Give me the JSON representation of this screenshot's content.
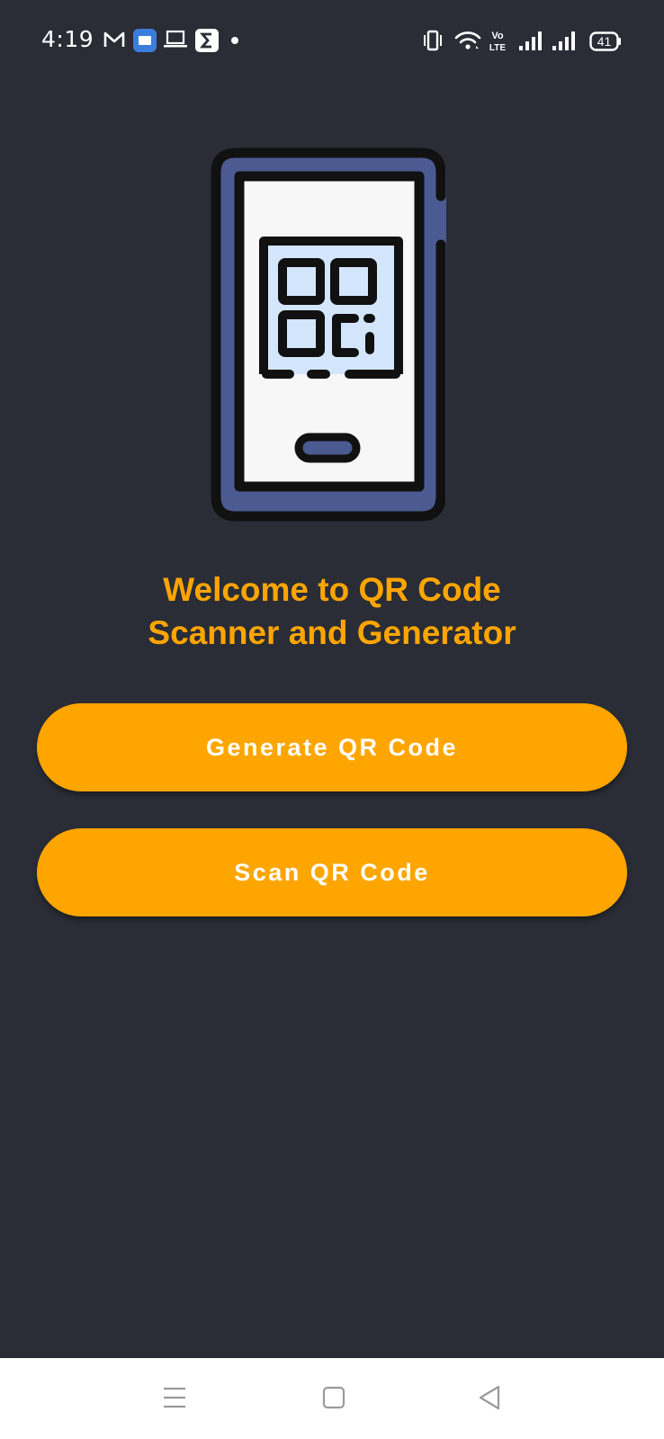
{
  "status_bar": {
    "time": "4:19",
    "battery": "41",
    "icons": [
      "gmail-icon",
      "messages-icon",
      "laptop-icon",
      "sigma-app-icon",
      "notification-dot-icon",
      "vibrate-icon",
      "wifi-icon",
      "volte-icon",
      "signal-sim1-icon",
      "signal-sim2-icon",
      "battery-icon"
    ]
  },
  "hero": {
    "icon": "phone-qr-code-illustration"
  },
  "welcome": {
    "line1": "Welcome to QR Code",
    "line2": "Scanner and Generator"
  },
  "buttons": {
    "generate": "Generate QR Code",
    "scan": "Scan QR Code"
  },
  "nav_bar": {
    "icons": [
      "menu-icon",
      "home-icon",
      "back-icon"
    ]
  },
  "colors": {
    "background": "#2a2d36",
    "accent": "#ffa500",
    "button_text": "#ffffff",
    "phone_frame": "#4b5b91"
  }
}
